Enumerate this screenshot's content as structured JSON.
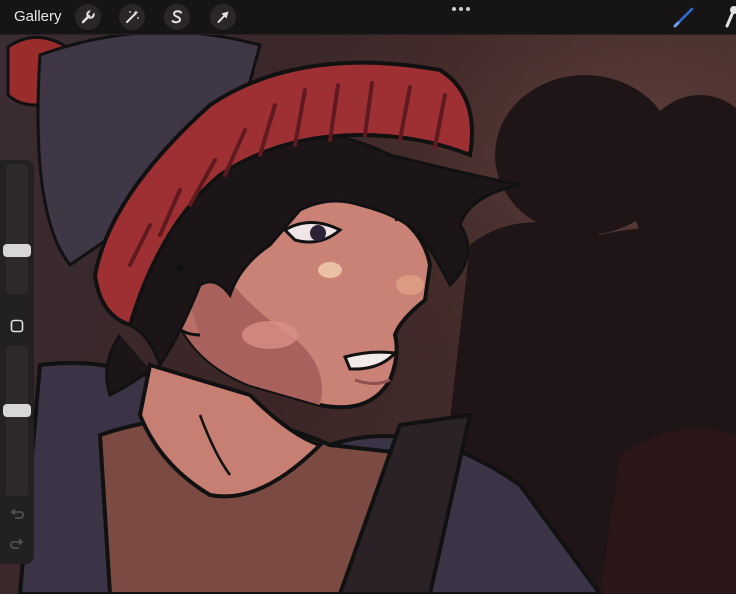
{
  "toolbar": {
    "gallery_label": "Gallery",
    "tools": [
      {
        "icon": "wrench-icon",
        "name": "actions-button"
      },
      {
        "icon": "magic-wand-icon",
        "name": "adjustments-button"
      },
      {
        "icon": "selection-s-icon",
        "name": "selection-button"
      },
      {
        "icon": "arrow-cursor-icon",
        "name": "transform-button"
      }
    ],
    "active_tool_icon": "brush-icon",
    "active_color": "#2f6bd6"
  },
  "sidebar": {
    "brush_size_level": 0.32,
    "opacity_level": 0.58,
    "modify_icon": "square-outline-icon",
    "undo_icon": "undo-arrow-icon",
    "redo_icon": "redo-arrow-icon"
  },
  "canvas": {
    "subject": "illustration"
  }
}
